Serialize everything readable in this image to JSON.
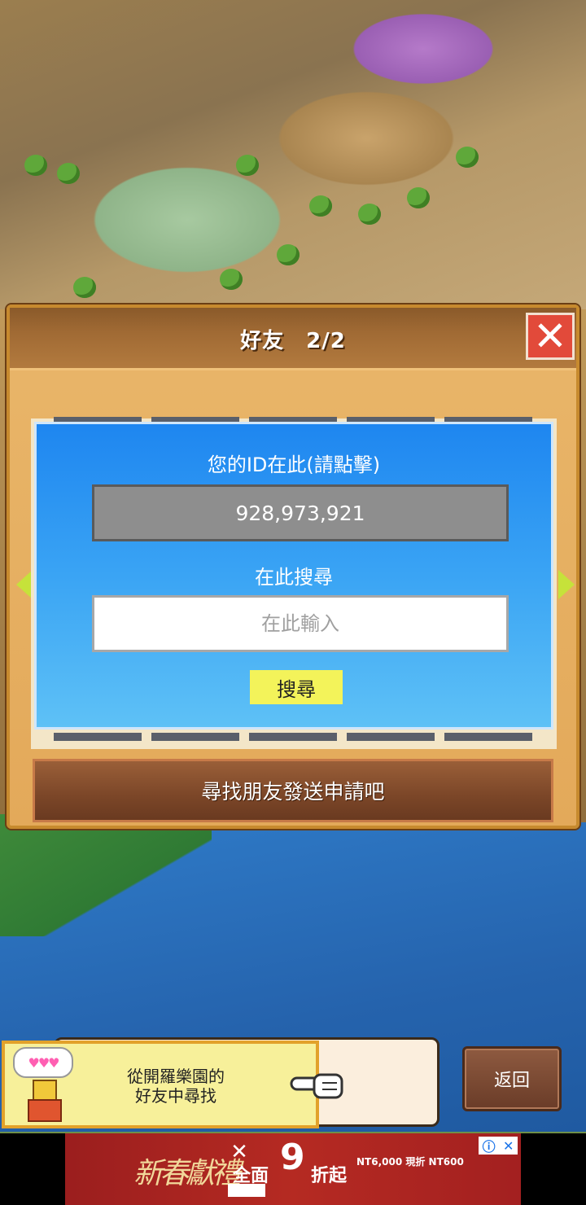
{
  "dialog": {
    "title": "好友　2/2",
    "close_icon": "close-icon"
  },
  "id_panel": {
    "id_label": "您的ID在此(請點擊)",
    "id_value": "928,973,921",
    "search_label": "在此搜尋",
    "search_placeholder": "在此輸入",
    "search_button": "搜尋"
  },
  "request_bar": {
    "label": "尋找朋友發送申請吧"
  },
  "notice": {
    "line1": "從開羅樂園的",
    "line2": "好友中尋找"
  },
  "back_button": {
    "label": "返回"
  },
  "ad": {
    "calligraphy": "新春獻禮",
    "headline_part1": "全面",
    "headline_number": "9",
    "headline_part2": "折起",
    "price_text": "NT6,000 現折 NT600"
  },
  "colors": {
    "accent_panel": "#1e86f0",
    "close_button": "#e24a3a",
    "search_button": "#f3f35a",
    "dialog_frame": "#e3a95a"
  }
}
